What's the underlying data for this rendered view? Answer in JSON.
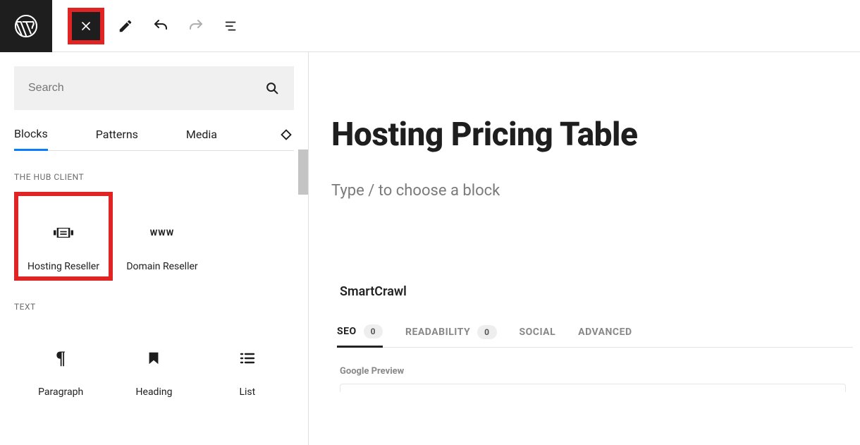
{
  "toolbar": {
    "icons": {
      "wp": "wordpress-logo",
      "close": "close-icon",
      "edit": "edit-icon",
      "undo": "undo-icon",
      "redo": "redo-icon",
      "details": "details-icon"
    }
  },
  "sidebar": {
    "search_placeholder": "Search",
    "tabs": {
      "blocks": "Blocks",
      "patterns": "Patterns",
      "media": "Media"
    },
    "groups": {
      "hub": {
        "title": "THE HUB CLIENT",
        "items": [
          {
            "label": "Hosting Reseller"
          },
          {
            "label": "Domain Reseller"
          }
        ]
      },
      "text": {
        "title": "TEXT",
        "items": [
          {
            "label": "Paragraph"
          },
          {
            "label": "Heading"
          },
          {
            "label": "List"
          }
        ]
      }
    }
  },
  "main": {
    "title": "Hosting Pricing Table",
    "placeholder": "Type / to choose a block"
  },
  "smartcrawl": {
    "title": "SmartCrawl",
    "tabs": {
      "seo": {
        "label": "SEO",
        "badge": "0"
      },
      "readability": {
        "label": "READABILITY",
        "badge": "0"
      },
      "social": {
        "label": "SOCIAL"
      },
      "advanced": {
        "label": "ADVANCED"
      }
    },
    "google_preview_label": "Google Preview"
  }
}
